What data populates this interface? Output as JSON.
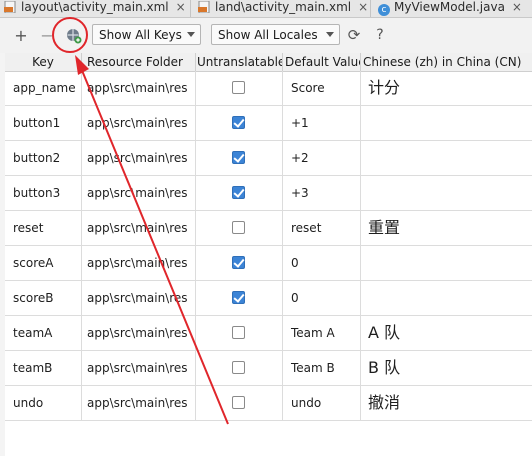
{
  "tabs": [
    {
      "label": "layout\\activity_main.xml",
      "icon": "xml-file-icon"
    },
    {
      "label": "land\\activity_main.xml",
      "icon": "xml-file-icon"
    },
    {
      "label": "MyViewModel.java",
      "icon": "java-class-icon"
    }
  ],
  "toolbar": {
    "add": "+",
    "remove": "−",
    "filter_keys": "Show All Keys",
    "filter_locales": "Show All Locales",
    "refresh": "⟳",
    "help": "?"
  },
  "table": {
    "columns": [
      "Key",
      "Resource Folder",
      "Untranslatable",
      "Default Value",
      "Chinese (zh) in China (CN)"
    ],
    "rows": [
      {
        "key": "app_name",
        "folder": "app\\src\\main\\res",
        "untranslatable": false,
        "default": "Score",
        "zh": "计分"
      },
      {
        "key": "button1",
        "folder": "app\\src\\main\\res",
        "untranslatable": true,
        "default": "+1",
        "zh": ""
      },
      {
        "key": "button2",
        "folder": "app\\src\\main\\res",
        "untranslatable": true,
        "default": "+2",
        "zh": ""
      },
      {
        "key": "button3",
        "folder": "app\\src\\main\\res",
        "untranslatable": true,
        "default": "+3",
        "zh": ""
      },
      {
        "key": "reset",
        "folder": "app\\src\\main\\res",
        "untranslatable": false,
        "default": "reset",
        "zh": "重置"
      },
      {
        "key": "scoreA",
        "folder": "app\\src\\main\\res",
        "untranslatable": true,
        "default": "0",
        "zh": ""
      },
      {
        "key": "scoreB",
        "folder": "app\\src\\main\\res",
        "untranslatable": true,
        "default": "0",
        "zh": ""
      },
      {
        "key": "teamA",
        "folder": "app\\src\\main\\res",
        "untranslatable": false,
        "default": "Team A",
        "zh": "A 队"
      },
      {
        "key": "teamB",
        "folder": "app\\src\\main\\res",
        "untranslatable": false,
        "default": "Team B",
        "zh": "B 队"
      },
      {
        "key": "undo",
        "folder": "app\\src\\main\\res",
        "untranslatable": false,
        "default": "undo",
        "zh": "撤消"
      }
    ]
  },
  "colors": {
    "annotation": "#e0262b",
    "checkbox_on": "#3c84d6"
  }
}
